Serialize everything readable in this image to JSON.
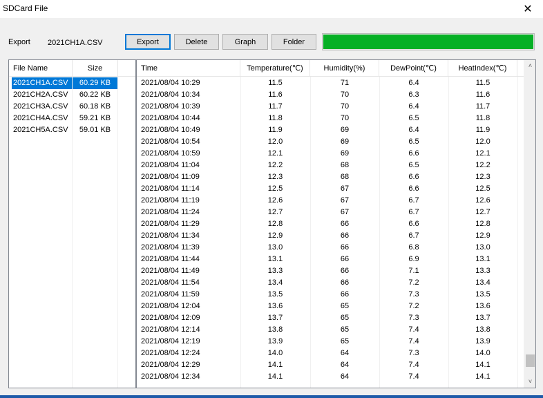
{
  "window": {
    "title": "SDCard File",
    "close_glyph": "✕"
  },
  "export": {
    "label": "Export",
    "filename": "2021CH1A.CSV"
  },
  "toolbar": {
    "export_label": "Export",
    "delete_label": "Delete",
    "graph_label": "Graph",
    "folder_label": "Folder"
  },
  "progress": {
    "value": 1.0,
    "color": "#06b025"
  },
  "files": {
    "headers": {
      "name": "File Name",
      "size": "Size"
    },
    "rows": [
      {
        "name": "2021CH1A.CSV",
        "size": "60.29 KB",
        "selected": true
      },
      {
        "name": "2021CH2A.CSV",
        "size": "60.22 KB"
      },
      {
        "name": "2021CH3A.CSV",
        "size": "60.18 KB"
      },
      {
        "name": "2021CH4A.CSV",
        "size": "59.21 KB"
      },
      {
        "name": "2021CH5A.CSV",
        "size": "59.01 KB"
      }
    ]
  },
  "data": {
    "headers": {
      "time": "Time",
      "temp": "Temperature(℃)",
      "hum": "Humidity(%)",
      "dew": "DewPoint(℃)",
      "heat": "HeatIndex(℃)"
    },
    "rows": [
      [
        "2021/08/04 10:29",
        "11.5",
        "71",
        "6.4",
        "11.5"
      ],
      [
        "2021/08/04 10:34",
        "11.6",
        "70",
        "6.3",
        "11.6"
      ],
      [
        "2021/08/04 10:39",
        "11.7",
        "70",
        "6.4",
        "11.7"
      ],
      [
        "2021/08/04 10:44",
        "11.8",
        "70",
        "6.5",
        "11.8"
      ],
      [
        "2021/08/04 10:49",
        "11.9",
        "69",
        "6.4",
        "11.9"
      ],
      [
        "2021/08/04 10:54",
        "12.0",
        "69",
        "6.5",
        "12.0"
      ],
      [
        "2021/08/04 10:59",
        "12.1",
        "69",
        "6.6",
        "12.1"
      ],
      [
        "2021/08/04 11:04",
        "12.2",
        "68",
        "6.5",
        "12.2"
      ],
      [
        "2021/08/04 11:09",
        "12.3",
        "68",
        "6.6",
        "12.3"
      ],
      [
        "2021/08/04 11:14",
        "12.5",
        "67",
        "6.6",
        "12.5"
      ],
      [
        "2021/08/04 11:19",
        "12.6",
        "67",
        "6.7",
        "12.6"
      ],
      [
        "2021/08/04 11:24",
        "12.7",
        "67",
        "6.7",
        "12.7"
      ],
      [
        "2021/08/04 11:29",
        "12.8",
        "66",
        "6.6",
        "12.8"
      ],
      [
        "2021/08/04 11:34",
        "12.9",
        "66",
        "6.7",
        "12.9"
      ],
      [
        "2021/08/04 11:39",
        "13.0",
        "66",
        "6.8",
        "13.0"
      ],
      [
        "2021/08/04 11:44",
        "13.1",
        "66",
        "6.9",
        "13.1"
      ],
      [
        "2021/08/04 11:49",
        "13.3",
        "66",
        "7.1",
        "13.3"
      ],
      [
        "2021/08/04 11:54",
        "13.4",
        "66",
        "7.2",
        "13.4"
      ],
      [
        "2021/08/04 11:59",
        "13.5",
        "66",
        "7.3",
        "13.5"
      ],
      [
        "2021/08/04 12:04",
        "13.6",
        "65",
        "7.2",
        "13.6"
      ],
      [
        "2021/08/04 12:09",
        "13.7",
        "65",
        "7.3",
        "13.7"
      ],
      [
        "2021/08/04 12:14",
        "13.8",
        "65",
        "7.4",
        "13.8"
      ],
      [
        "2021/08/04 12:19",
        "13.9",
        "65",
        "7.4",
        "13.9"
      ],
      [
        "2021/08/04 12:24",
        "14.0",
        "64",
        "7.3",
        "14.0"
      ],
      [
        "2021/08/04 12:29",
        "14.1",
        "64",
        "7.4",
        "14.1"
      ],
      [
        "2021/08/04 12:34",
        "14.1",
        "64",
        "7.4",
        "14.1"
      ]
    ]
  },
  "scrollbar": {
    "up_glyph": "˄",
    "down_glyph": "˅",
    "position": 0.97
  }
}
